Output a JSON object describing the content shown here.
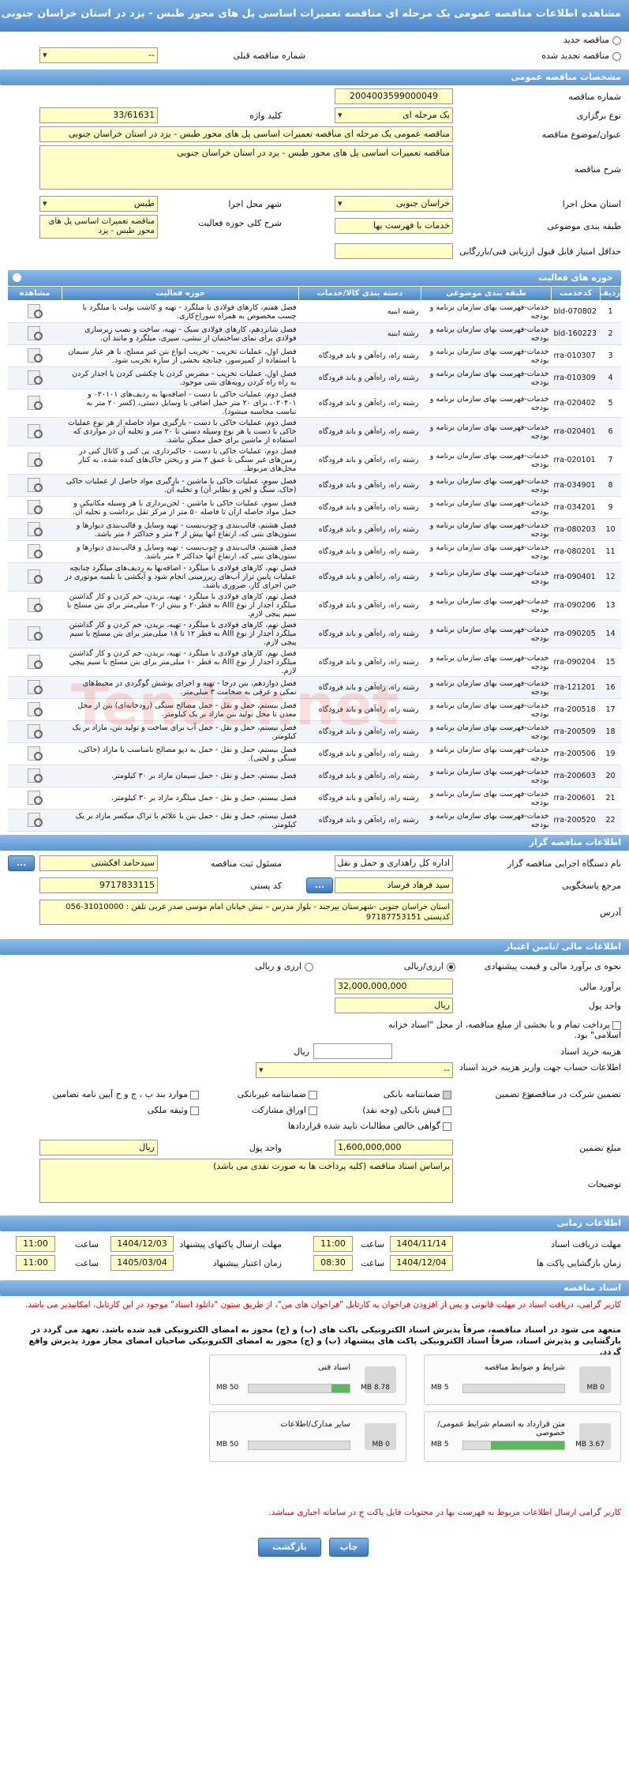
{
  "title": "مشاهده اطلاعات مناقصه عمومی یک مرحله ای مناقصه تعمیرات اساسی پل های محور طبس - یزد در استان خراسان جنوبی",
  "top": {
    "new_tender": "مناقصه جدید",
    "renewed_tender": "مناقصه تجدید شده",
    "prev_tender_label": "شماره مناقصه قبلی",
    "prev_tender_value": "--"
  },
  "general": {
    "header": "مشخصات مناقصه عمومی",
    "number_label": "شماره مناقصه",
    "number": "2004003599000049",
    "type_label": "نوع برگزاری",
    "type": "یک مرحله ای",
    "keyword_label": "کلید واژه",
    "keyword": "33/61631",
    "subject_label": "عنوان/موضوع مناقصه",
    "subject": "مناقصه عمومی یک مرحله ای مناقصه تعمیرات اساسی پل های محور طبس - یزد در استان خراسان جنوبی",
    "desc_label": "شرح مناقصه",
    "desc": "مناقصه تعمیرات اساسی پل های محور طبس - یزد در استان خراسان جنوبی",
    "province_label": "استان محل اجرا",
    "province": "خراسان جنوبی",
    "city_label": "شهر محل اجرا",
    "city": "طبس",
    "category_label": "طبقه بندی موضوعی",
    "category": "خدمات با فهرست بها",
    "activity_label": "شرح کلی حوزه فعالیت",
    "activity": "مناقصه تعمیرات اساسی پل های محور طبس - یزد",
    "min_score_label": "حداقل امتیاز قابل قبول ارزیابی فنی/بازرگانی",
    "min_score": ""
  },
  "items": {
    "header": "حوزه های فعالیت",
    "columns": [
      "ردیف",
      "کدخدمت",
      "طبقه بندی موضوعی",
      "دسته بندی کالا/خدمات",
      "حوزه فعالیت",
      "مشاهده"
    ],
    "rows": [
      [
        "1",
        "bld-070802",
        "خدمات-فهرست بهای سازمان برنامه و بودجه",
        "رشته ابنیه",
        "فصل هفتم، کارهای فولادی با میلگرد - تهیه و کاشت بولت با میلگرد با چسب مخصوص به همراه سوراخ‌کاری."
      ],
      [
        "2",
        "bld-160223",
        "خدمات-فهرست بهای سازمان برنامه و بودجه",
        "رشته ابنیه",
        "فصل شانزدهم، کارهای فولادی سبک - تهیه، ساخت و نصب زیرسازی فولادی برای نمای ساختمان از نبشی، سپری، میلگرد و مانند آن."
      ],
      [
        "3",
        "rra-010307",
        "خدمات-فهرست بهای سازمان برنامه و بودجه",
        "رشته راه، راه‌آهن و باند فرودگاه",
        "فصل اول، عملیات تخریب - تخریب انواع بتن غیر مسلح، با هر عیار سیمان با استفاده از کمپرسور، چنانچه بخشی از سازه تخریب شود."
      ],
      [
        "4",
        "rra-010309",
        "خدمات-فهرست بهای سازمان برنامه و بودجه",
        "رشته راه، راه‌آهن و باند فرودگاه",
        "فصل اول، عملیات تخریب - مضرس کردن یا چکشی کردن یا اجدار کردن به راه راه کردن رویه‌های بتنی موجود."
      ],
      [
        "5",
        "rra-020402",
        "خدمات-فهرست بهای سازمان برنامه و بودجه",
        "رشته راه، راه‌آهن و باند فرودگاه",
        "فصل دوم، عملیات خاکی با دست - اضافه‌بها به ردیف‌های ۰۲۰۱۰۱ و ۰۲۰۴۰۱، برای ۲۰ متر حمل اضافی یا وسایل دستی، (کسر ۲۰ متر به تناسب محاسبه میشود)."
      ],
      [
        "6",
        "rra-020401",
        "خدمات-فهرست بهای سازمان برنامه و بودجه",
        "رشته راه، راه‌آهن و باند فرودگاه",
        "فصل دوم، عملیات خاکی با دست - بارگیری مواد حاصله از هر نوع عملیات خاکی با دست یا هر نوع وسیله دستی تا ۲۰ متر و تخلیه آن در مواردی که استفاده از ماشین برای حمل ممکن نباشد."
      ],
      [
        "7",
        "rra-020101",
        "خدمات-فهرست بهای سازمان برنامه و بودجه",
        "رشته راه، راه‌آهن و باند فرودگاه",
        "فصل دوم، عملیات خاکی با دست - خاکبرداری، پی کنی و کانال کنی در زمین‌های غیر سنگی تا عمق ۲ متر و ریختن خاک‌های کنده شده، به کنار محل‌های مربوط."
      ],
      [
        "8",
        "rra-034901",
        "خدمات-فهرست بهای سازمان برنامه و بودجه",
        "رشته راه، راه‌آهن و باند فرودگاه",
        "فصل سوم، عملیات خاکی با ماشین - بارگیری مواد حاصل از عملیات خاکی (خاک، سنگ و لجن و نظایر آن) و تخلیه آن."
      ],
      [
        "9",
        "rra-034201",
        "خدمات-فهرست بهای سازمان برنامه و بودجه",
        "رشته راه، راه‌آهن و باند فرودگاه",
        "فصل سوم، عملیات خاکی با ماشین - لجن‌برداری با هر وسیله مکانیکی و حمل مواد حاصله ازآن تا فاصله ۵۰ متر از مرکز ثقل برداشت و تخلیه آن."
      ],
      [
        "10",
        "rra-080203",
        "خدمات-فهرست بهای سازمان برنامه و بودجه",
        "رشته راه، راه‌آهن و باند فرودگاه",
        "فصل هشتم، قالب‌بندی و چوب‌بست - تهیه وسایل و قالب‌بندی دیوارها و ستون‌های بتنی که، ارتفاع آنها بیش از ۴ متر و حداکثر ۶ متر باشد."
      ],
      [
        "11",
        "rra-080201",
        "خدمات-فهرست بهای سازمان برنامه و بودجه",
        "رشته راه، راه‌آهن و باند فرودگاه",
        "فصل هشتم، قالب‌بندی و چوب‌بست - تهیه وسایل و قالب‌بندی دیوارها و ستون‌های بتنی که، ارتفاع آنها حداکثر ۲ متر باشد."
      ],
      [
        "12",
        "rra-090401",
        "خدمات-فهرست بهای سازمان برنامه و بودجه",
        "رشته راه، راه‌آهن و باند فرودگاه",
        "فصل نهم، کارهای فولادی با میلگرد - اضافه‌بها به ردیف‌های میلگرد چنانچه عملیات پایین تراز آب‌های زیرزمینی انجام شود و آبکشی با تلمبه موتوری در حین اجرای کار، ضروری باشد."
      ],
      [
        "13",
        "rra-090206",
        "خدمات-فهرست بهای سازمان برنامه و بودجه",
        "رشته راه، راه‌آهن و باند فرودگاه",
        "فصل نهم، کارهای فولادی با میلگرد - تهیه، بریدن، خم کردن و کار گذاشتن میلگرد آجدار از نوع AIII به قطر۲۰ و بیش از۲۰ میلی‌متر برای بتن مسلح با سیم پیچی لازم."
      ],
      [
        "14",
        "rra-090205",
        "خدمات-فهرست بهای سازمان برنامه و بودجه",
        "رشته راه، راه‌آهن و باند فرودگاه",
        "فصل نهم، کارهای فولادی با میلگرد - تهیه، بریدن، خم کردن و کار گذاشتن میلگرد آجدار از نوع AIII به قطر ۱۲ تا ۱۸ میلی‌متر برای بتن مسلح با سیم پیچی لازم."
      ],
      [
        "15",
        "rra-090204",
        "خدمات-فهرست بهای سازمان برنامه و بودجه",
        "رشته راه، راه‌آهن و باند فرودگاه",
        "فصل نهم، کارهای فولادی با میلگرد - تهیه، بریدن، خم کردن و کار گذاشتن میلگرد آجدار از نوع AIII به قطر ۱۰ میلی‌متر برای بتن مسلح با سیم پیچی لازم."
      ],
      [
        "16",
        "rra-121201",
        "خدمات-فهرست بهای سازمان برنامه و بودجه",
        "رشته راه، راه‌آهن و باند فرودگاه",
        "فصل دوازدهم، بتن درجا - تهیه و اجرای پوشش گوگردی در محیط‌های نمکی و عرقی به ضخامت ۳ میلی‌متر."
      ],
      [
        "17",
        "rra-200518",
        "خدمات-فهرست بهای سازمان برنامه و بودجه",
        "رشته راه، راه‌آهن و باند فرودگاه",
        "فصل بیستم، حمل و نقل - حمل مصالح سنگی (رودخانه‌ای) بتن از محل معدن تا محل تولید بتن مازاد بر یک کیلومتر."
      ],
      [
        "18",
        "rra-200509",
        "خدمات-فهرست بهای سازمان برنامه و بودجه",
        "رشته راه، راه‌آهن و باند فرودگاه",
        "فصل بیستم، حمل و نقل - حمل آب برای ساخت و تولید بتن، مازاد بر یک کیلومتر."
      ],
      [
        "19",
        "rra-200506",
        "خدمات-فهرست بهای سازمان برنامه و بودجه",
        "رشته راه، راه‌آهن و باند فرودگاه",
        "فصل بیستم، حمل و نقل - حمل به دپو مصالح نامناسب یا مازاد (خاکی، سنگی و لجنی)."
      ],
      [
        "20",
        "rra-200603",
        "خدمات-فهرست بهای سازمان برنامه و بودجه",
        "رشته راه، راه‌آهن و باند فرودگاه",
        "فصل بیستم، حمل و نقل - حمل سیمان مازاد بر ۳۰ کیلومتر."
      ],
      [
        "21",
        "rra-200601",
        "خدمات-فهرست بهای سازمان برنامه و بودجه",
        "رشته راه، راه‌آهن و باند فرودگاه",
        "فصل بیستم، حمل و نقل - حمل میلگرد مازاد بر ۳۰ کیلومتر."
      ],
      [
        "22",
        "rra-200520",
        "خدمات-فهرست بهای سازمان برنامه و بودجه",
        "رشته راه، راه‌آهن و باند فرودگاه",
        "فصل بیستم، حمل و نقل - حمل بتن با علائم با تراک میکسر مازاد بر یک کیلومتر."
      ]
    ]
  },
  "organizer": {
    "header": "اطلاعات مناقصه گزار",
    "org_label": "نام دستگاه اجرایی مناقصه گزار",
    "org": "اداره کل راهداری و حمل و نقل",
    "responsible_label": "مسئول ثبت مناقصه",
    "responsible": "سیدحامد افکشتی",
    "ref_label": "مرجع پاسخگویی",
    "ref": "سید فرهاد فرساد",
    "postal_label": "کد پستی",
    "postal": "9717833115",
    "address_label": "آدرس",
    "address1": "استان خراسان جنوبی -شهرستان بیرجند - بلوار مدرس – نبش خیابان امام موسی صدر غربی   تلفن : 31010000-056 کدپستی  97187753151",
    "btn": "..."
  },
  "finance": {
    "header": "اطلاعات مالی /تامین اعتبار",
    "estimate_type_label": "نحوه ی برآورد مالی و قیمت پیشنهادی",
    "currency_rial": "ارزی/ریالی",
    "currency_both": "ارزی و ریالی",
    "estimate_label": "برآورد مالی",
    "estimate": "32,000,000,000",
    "unit_label": "واحد پول",
    "unit": "ریال",
    "payment_note": "پرداخت تمام و یا بخشی از مبلغ مناقصه، از محل \"اسناد خزانه اسلامی\" بود.",
    "doc_cost_label": "هزینه خرید اسناد",
    "doc_cost_unit": "ریال",
    "bank_label": "اطلاعات حساب جهت واریز هزینه خرید اسناد",
    "bank_value": "--",
    "guarantee_type_label": "تضمین شرکت در مناقصه:",
    "guarantee_kind_label": "نوع تضمین",
    "g1": "ضمانتنامه بانکی",
    "g2": "ضمانتنامه غیربانکی",
    "g3": "موارد بند ب ، ج و ح آیین نامه تضامین",
    "g4": "فیش بانکی (وجه نقد)",
    "g5": "اوراق مشارکت",
    "g6": "وثیقه ملکی",
    "g7": "گواهی خالص مطالبات تایید شده قراردادها",
    "guarantee_amount_label": "مبلغ تضمین",
    "guarantee_amount": "1,600,000,000",
    "guarantee_unit_label": "واحد پول",
    "guarantee_unit": "ریال",
    "notes_label": "توضیحات",
    "notes": "براساس اسناد مناقصه (کلیه پرداخت ها به صورت نقدی می باشد)"
  },
  "timing": {
    "header": "اطلاعات زمانی",
    "get_doc_label": "مهلت دریافت اسناد",
    "get_doc_date": "1404/11/14",
    "get_doc_time": "11:00",
    "send_label": "مهلت ارسال پاکتهای پیشنهاد",
    "send_date": "1404/12/03",
    "send_time": "11:00",
    "open_label": "زمان بازگشایی پاکت ها",
    "open_date": "1404/12/04",
    "open_time": "08:30",
    "valid_label": "زمان اعتبار پیشنهاد",
    "valid_date": "1405/03/04",
    "valid_time": "11:00",
    "time_label": "ساعت"
  },
  "docs": {
    "header": "اسناد مناقصه",
    "note1": "کاربر گرامی، دریافت اسناد در مهلت قانونی و پس از افزودن فراخوان به کارتابل \"فراخوان های من\"، از طریق ستون \"دانلود اسناد\" موجود در این کارتابل، امکانپذیر می باشد.",
    "note2": "متعهد می شود در اسناد مناقصه، صرفاً پذیرش اسناد الکترونیکی پاکت های (ب) و (ج) مجوز به امضای الکترونیکی قید شده باشد. تعهد می گردد در بارگشایی و پذیرش اسناد، صرفاً اسناد الکترونیکی پاکت های پیشنهاد (ب) و (ج) مجوز به امضای الکترونیکی صاحبان امضای مجاز مورد پذیرش واقع گردد.",
    "files": [
      {
        "title": "شرایط و ضوابط مناقصه",
        "size": "0 MB",
        "max": "5 MB",
        "fill": 0
      },
      {
        "title": "اسناد فنی",
        "size": "8.78 MB",
        "max": "50 MB",
        "fill": 0.18
      },
      {
        "title": "متن قرارداد به انضمام شرایط عمومی/خصوصی",
        "size": "3.67 MB",
        "max": "5 MB",
        "fill": 0.73
      },
      {
        "title": "سایر مدارک/اطلاعات",
        "size": "0 MB",
        "max": "50 MB",
        "fill": 0
      }
    ],
    "note3": "کاربر گرامی ارسال اطلاعات مربوط به فهرست بها در محتویات فایل پاکت ج در سامانه اجباری میباشد."
  },
  "footer": {
    "print": "چاپ",
    "back": "بازگشت"
  }
}
